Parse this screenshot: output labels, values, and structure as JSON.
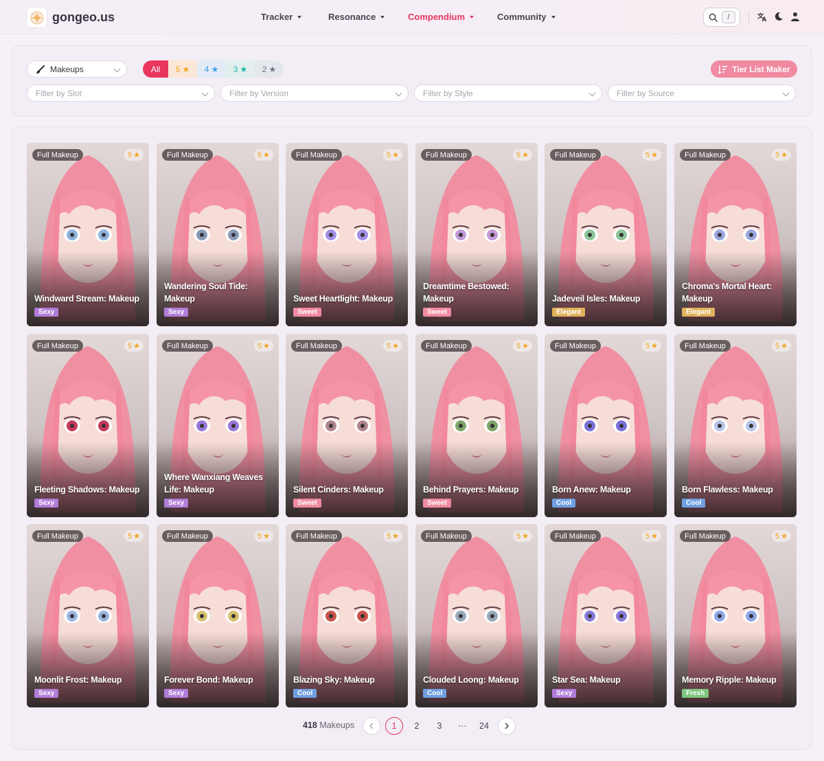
{
  "header": {
    "logo_text": "gongeo.us",
    "nav": [
      {
        "label": "Tracker",
        "active": false
      },
      {
        "label": "Resonance",
        "active": false
      },
      {
        "label": "Compendium",
        "active": true
      },
      {
        "label": "Community",
        "active": false
      }
    ],
    "search_shortcut": "/",
    "icons": [
      "search-icon",
      "translate-icon",
      "moon-icon",
      "user-icon"
    ]
  },
  "filters": {
    "category": "Makeups",
    "rarity": [
      {
        "label": "All",
        "active": true
      },
      {
        "label": "5",
        "color": "#f2a31b"
      },
      {
        "label": "4",
        "color": "#3b9be5"
      },
      {
        "label": "3",
        "color": "#1fb5a5"
      },
      {
        "label": "2",
        "color": "#6b7686"
      }
    ],
    "tier_button": "Tier List Maker",
    "slot_placeholder": "Filter by Slot",
    "version_placeholder": "Filter by Version",
    "style_placeholder": "Filter by Style",
    "source_placeholder": "Filter by Source"
  },
  "style_colors": {
    "Sexy": "#b17cd8",
    "Sweet": "#f08aa0",
    "Elegant": "#e0b05a",
    "Cool": "#6f9fe0",
    "Fresh": "#7dc47d"
  },
  "cards": [
    {
      "type": "Full Makeup",
      "stars": "5",
      "name": "Windward Stream: Makeup",
      "style": "Sexy",
      "eye": "#8fb4de"
    },
    {
      "type": "Full Makeup",
      "stars": "5",
      "name": "Wandering Soul Tide: Makeup",
      "style": "Sexy",
      "eye": "#8a9ab8"
    },
    {
      "type": "Full Makeup",
      "stars": "5",
      "name": "Sweet Heartlight: Makeup",
      "style": "Sweet",
      "eye": "#a48ee6"
    },
    {
      "type": "Full Makeup",
      "stars": "5",
      "name": "Dreamtime Bestowed: Makeup",
      "style": "Sweet",
      "eye": "#c49ad6"
    },
    {
      "type": "Full Makeup",
      "stars": "5",
      "name": "Jadeveil Isles: Makeup",
      "style": "Elegant",
      "eye": "#8fc49a"
    },
    {
      "type": "Full Makeup",
      "stars": "5",
      "name": "Chroma's Mortal Heart: Makeup",
      "style": "Elegant",
      "eye": "#9aa8e0"
    },
    {
      "type": "Full Makeup",
      "stars": "5",
      "name": "Fleeting Shadows: Makeup",
      "style": "Sexy",
      "eye": "#c83a5a"
    },
    {
      "type": "Full Makeup",
      "stars": "5",
      "name": "Where Wanxiang Weaves Life: Makeup",
      "style": "Sexy",
      "eye": "#9a78d8"
    },
    {
      "type": "Full Makeup",
      "stars": "5",
      "name": "Silent Cinders: Makeup",
      "style": "Sweet",
      "eye": "#b0868e"
    },
    {
      "type": "Full Makeup",
      "stars": "5",
      "name": "Behind Prayers: Makeup",
      "style": "Sweet",
      "eye": "#7ea46a"
    },
    {
      "type": "Full Makeup",
      "stars": "5",
      "name": "Born Anew: Makeup",
      "style": "Cool",
      "eye": "#7a70d8"
    },
    {
      "type": "Full Makeup",
      "stars": "5",
      "name": "Born Flawless: Makeup",
      "style": "Cool",
      "eye": "#b8c4e8"
    },
    {
      "type": "Full Makeup",
      "stars": "5",
      "name": "Moonlit Frost: Makeup",
      "style": "Sexy",
      "eye": "#9ab6e0"
    },
    {
      "type": "Full Makeup",
      "stars": "5",
      "name": "Forever Bond: Makeup",
      "style": "Sexy",
      "eye": "#d8c070"
    },
    {
      "type": "Full Makeup",
      "stars": "5",
      "name": "Blazing Sky: Makeup",
      "style": "Cool",
      "eye": "#c8544a"
    },
    {
      "type": "Full Makeup",
      "stars": "5",
      "name": "Clouded Loong: Makeup",
      "style": "Cool",
      "eye": "#98a8bc"
    },
    {
      "type": "Full Makeup",
      "stars": "5",
      "name": "Star Sea: Makeup",
      "style": "Sexy",
      "eye": "#8a7ad8"
    },
    {
      "type": "Full Makeup",
      "stars": "5",
      "name": "Memory Ripple: Makeup",
      "style": "Fresh",
      "eye": "#8ea6e6"
    }
  ],
  "pagination": {
    "total_count": "418",
    "unit": "Makeups",
    "pages": [
      "1",
      "2",
      "3",
      "···",
      "24"
    ],
    "current": "1"
  }
}
